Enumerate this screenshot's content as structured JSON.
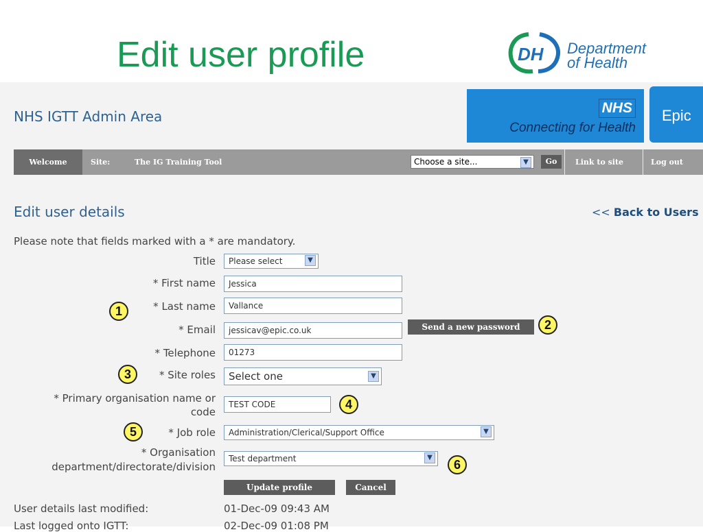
{
  "slide": {
    "title": "Edit user profile",
    "logo": {
      "mark": "DH",
      "line1": "Department",
      "line2": "of Health"
    }
  },
  "app": {
    "title": "NHS IGTT Admin Area",
    "nhs_word": "NHS",
    "nhs_tagline": "Connecting for Health",
    "epic_label": "Epic"
  },
  "nav": {
    "welcome": "Welcome",
    "site_label": "Site:",
    "site_name": "The IG Training Tool",
    "site_select": "Choose a site...",
    "go": "Go",
    "link_to_site": "Link to site",
    "log_out": "Log out"
  },
  "page": {
    "heading": "Edit user details",
    "back_prefix": "<<",
    "back_link": "Back to Users",
    "note": "Please note that fields marked with a * are mandatory."
  },
  "form": {
    "title": {
      "label": "Title",
      "value": "Please select"
    },
    "first_name": {
      "label": "* First name",
      "value": "Jessica"
    },
    "last_name": {
      "label": "* Last name",
      "value": "Vallance"
    },
    "email": {
      "label": "* Email",
      "value": "jessicav@epic.co.uk"
    },
    "send_password": "Send a new password",
    "telephone": {
      "label": "* Telephone",
      "value": "01273"
    },
    "site_roles": {
      "label": "* Site roles",
      "value": "Select one"
    },
    "primary_org": {
      "label_line1": "* Primary organisation name or",
      "label_line2": "code",
      "value": "TEST CODE"
    },
    "job_role": {
      "label": "* Job role",
      "value": "Administration/Clerical/Support Office"
    },
    "org_department": {
      "label_line1": "* Organisation",
      "label_line2": "department/directorate/division",
      "value": "Test department"
    },
    "update_button": "Update profile",
    "cancel_button": "Cancel"
  },
  "meta": {
    "last_modified_label": "User details last modified:",
    "last_modified_value": "01-Dec-09 09:43 AM",
    "last_logged_label": "Last logged onto IGTT:",
    "last_logged_value": "02-Dec-09 01:08 PM"
  },
  "callouts": [
    "1",
    "2",
    "3",
    "4",
    "5",
    "6"
  ],
  "colors": {
    "title_green": "#1a9a55",
    "nhs_blue": "#1e87d6",
    "heading_blue": "#2e6190",
    "callout_yellow": "#fff666"
  }
}
